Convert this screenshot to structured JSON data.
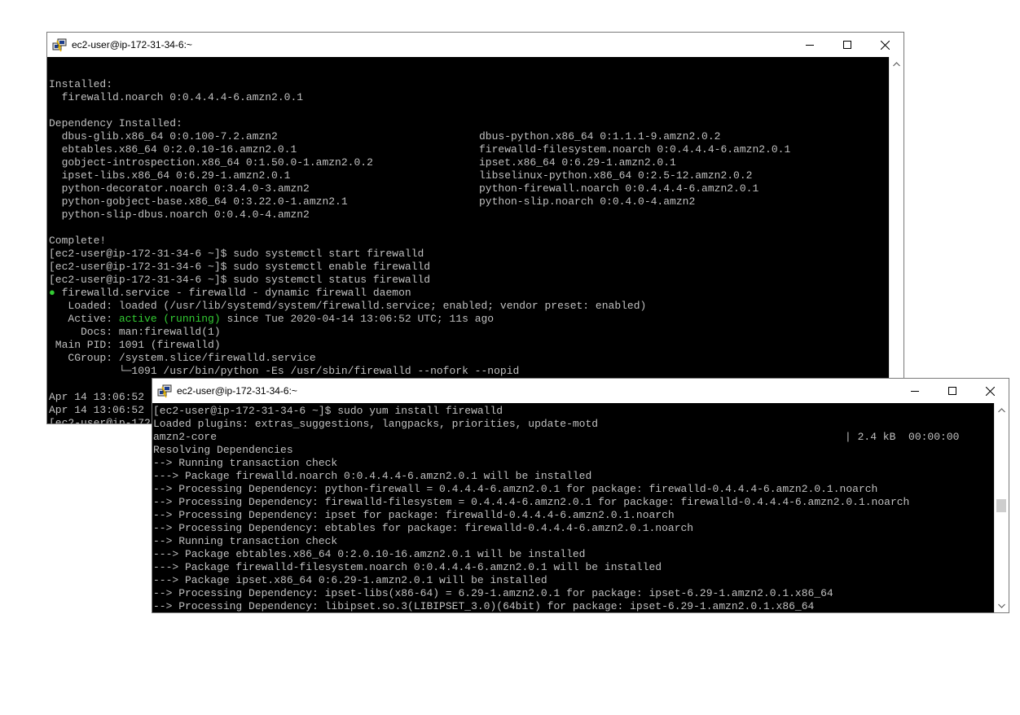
{
  "window1": {
    "title": "ec2-user@ip-172-31-34-6:~",
    "lines": [
      {
        "t": ""
      },
      {
        "t": "Installed:"
      },
      {
        "t": "  firewalld.noarch 0:0.4.4.4-6.amzn2.0.1"
      },
      {
        "t": ""
      },
      {
        "t": "Dependency Installed:"
      },
      {
        "t": "  dbus-glib.x86_64 0:0.100-7.2.amzn2",
        "c2": "dbus-python.x86_64 0:1.1.1-9.amzn2.0.2"
      },
      {
        "t": "  ebtables.x86_64 0:2.0.10-16.amzn2.0.1",
        "c2": "firewalld-filesystem.noarch 0:0.4.4.4-6.amzn2.0.1"
      },
      {
        "t": "  gobject-introspection.x86_64 0:1.50.0-1.amzn2.0.2",
        "c2": "ipset.x86_64 0:6.29-1.amzn2.0.1"
      },
      {
        "t": "  ipset-libs.x86_64 0:6.29-1.amzn2.0.1",
        "c2": "libselinux-python.x86_64 0:2.5-12.amzn2.0.2"
      },
      {
        "t": "  python-decorator.noarch 0:3.4.0-3.amzn2",
        "c2": "python-firewall.noarch 0:0.4.4.4-6.amzn2.0.1"
      },
      {
        "t": "  python-gobject-base.x86_64 0:3.22.0-1.amzn2.1",
        "c2": "python-slip.noarch 0:0.4.0-4.amzn2"
      },
      {
        "t": "  python-slip-dbus.noarch 0:0.4.0-4.amzn2"
      },
      {
        "t": ""
      },
      {
        "t": "Complete!"
      },
      {
        "t": "[ec2-user@ip-172-31-34-6 ~]$ sudo systemctl start firewalld"
      },
      {
        "t": "[ec2-user@ip-172-31-34-6 ~]$ sudo systemctl enable firewalld"
      },
      {
        "t": "[ec2-user@ip-172-31-34-6 ~]$ sudo systemctl status firewalld"
      },
      {
        "pre_green": "●",
        "t": " firewalld.service - firewalld - dynamic firewall daemon"
      },
      {
        "t": "   Loaded: loaded (/usr/lib/systemd/system/firewalld.service; enabled; vendor preset: enabled)"
      },
      {
        "t": "   Active: ",
        "green": "active (running)",
        "post": " since Tue 2020-04-14 13:06:52 UTC; 11s ago"
      },
      {
        "t": "     Docs: man:firewalld(1)"
      },
      {
        "t": " Main PID: 1091 (firewalld)"
      },
      {
        "t": "   CGroup: /system.slice/firewalld.service"
      },
      {
        "t": "           └─1091 /usr/bin/python -Es /usr/sbin/firewalld --nofork --nopid"
      },
      {
        "t": ""
      },
      {
        "t": "Apr 14 13:06:52"
      },
      {
        "t": "Apr 14 13:06:52"
      },
      {
        "t": "[ec2-user@ip-172"
      }
    ]
  },
  "window2": {
    "title": "ec2-user@ip-172-31-34-6:~",
    "lines": [
      {
        "t": "[ec2-user@ip-172-31-34-6 ~]$ sudo yum install firewalld"
      },
      {
        "t": "Loaded plugins: extras_suggestions, langpacks, priorities, update-motd"
      },
      {
        "t": "amzn2-core",
        "c2": "| 2.4 kB  00:00:00"
      },
      {
        "t": "Resolving Dependencies"
      },
      {
        "t": "--> Running transaction check"
      },
      {
        "t": "---> Package firewalld.noarch 0:0.4.4.4-6.amzn2.0.1 will be installed"
      },
      {
        "t": "--> Processing Dependency: python-firewall = 0.4.4.4-6.amzn2.0.1 for package: firewalld-0.4.4.4-6.amzn2.0.1.noarch"
      },
      {
        "t": "--> Processing Dependency: firewalld-filesystem = 0.4.4.4-6.amzn2.0.1 for package: firewalld-0.4.4.4-6.amzn2.0.1.noarch"
      },
      {
        "t": "--> Processing Dependency: ipset for package: firewalld-0.4.4.4-6.amzn2.0.1.noarch"
      },
      {
        "t": "--> Processing Dependency: ebtables for package: firewalld-0.4.4.4-6.amzn2.0.1.noarch"
      },
      {
        "t": "--> Running transaction check"
      },
      {
        "t": "---> Package ebtables.x86_64 0:2.0.10-16.amzn2.0.1 will be installed"
      },
      {
        "t": "---> Package firewalld-filesystem.noarch 0:0.4.4.4-6.amzn2.0.1 will be installed"
      },
      {
        "t": "---> Package ipset.x86_64 0:6.29-1.amzn2.0.1 will be installed"
      },
      {
        "t": "--> Processing Dependency: ipset-libs(x86-64) = 6.29-1.amzn2.0.1 for package: ipset-6.29-1.amzn2.0.1.x86_64"
      },
      {
        "t": "--> Processing Dependency: libipset.so.3(LIBIPSET_3.0)(64bit) for package: ipset-6.29-1.amzn2.0.1.x86_64"
      }
    ]
  },
  "icons": {
    "app": "putty-icon",
    "minimize": "minimize-icon",
    "maximize": "maximize-icon",
    "close": "close-icon",
    "scroll_up": "scroll-up-arrow-icon",
    "scroll_down": "scroll-down-arrow-icon"
  },
  "colors": {
    "terminal_bg": "#000000",
    "terminal_fg": "#c0c0c0",
    "active_green": "#33cc33"
  }
}
